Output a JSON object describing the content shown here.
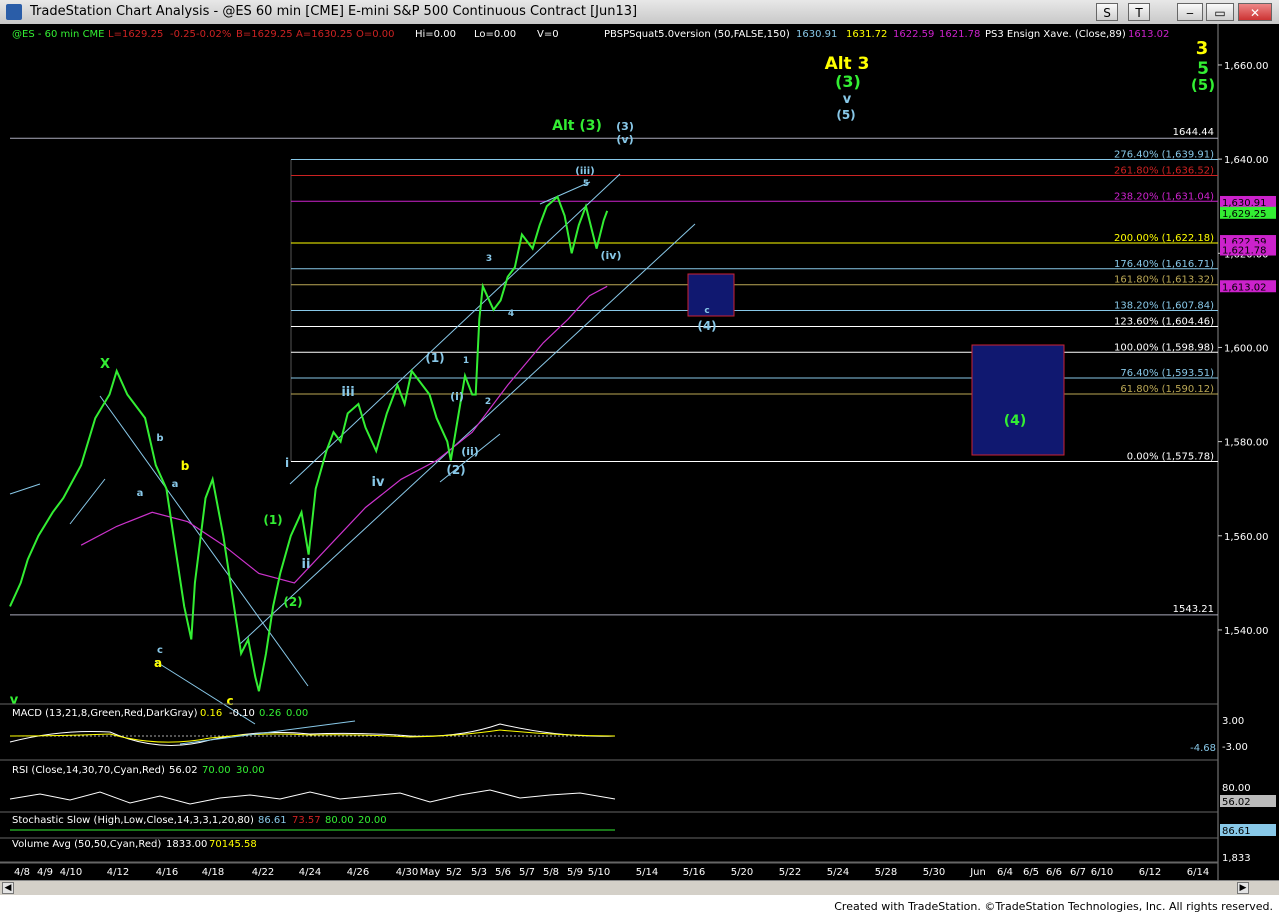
{
  "window": {
    "title": "TradeStation Chart Analysis - @ES 60 min [CME] E-mini S&P 500 Continuous Contract [Jun13]",
    "buttons": [
      "S",
      "T",
      "▭",
      "▭",
      "✕"
    ]
  },
  "colors": {
    "background": "#000000",
    "price": "#33ee33",
    "cyan": "#88c8e8",
    "ma": "#cc33cc",
    "yellow": "#ffff00",
    "fib_red": "#cc2222",
    "fib_magenta": "#cc22cc",
    "fib_olive": "#bba855",
    "box": "#101870"
  },
  "header": {
    "symbol": "@ES - 60 min  CME",
    "L": "L=1629.25",
    "chg": "-0.25",
    "pct": "-0.02%",
    "B": "B=1629.25",
    "A": "A=1630.25",
    "O": "O=0.00",
    "Hi": "Hi=0.00",
    "Lo": "Lo=0.00",
    "V": "V=0",
    "indicator_name": "PBSPSquat5.0version (50,FALSE,150)",
    "ind_vals": [
      "1630.91",
      "1631.72",
      "1622.59",
      "1621.78"
    ],
    "ind2_name": "PS3 Ensign Xave. (Close,89)",
    "ind2_val": "1613.02"
  },
  "chart_data": {
    "type": "line",
    "title": "@ES 60 min E-mini S&P 500 Continuous Contract",
    "ylim": [
      1523,
      1667
    ],
    "y_ticks": [
      {
        "v": 1660,
        "label": "1,660.00"
      },
      {
        "v": 1640,
        "label": "1,640.00"
      },
      {
        "v": 1620,
        "label": "1,620.00"
      },
      {
        "v": 1600,
        "label": "1,600.00"
      },
      {
        "v": 1580,
        "label": "1,580.00"
      },
      {
        "v": 1560,
        "label": "1,560.00"
      },
      {
        "v": 1540,
        "label": "1,540.00"
      }
    ],
    "x_labels": [
      "4/8",
      "4/9",
      "4/10",
      "4/12",
      "4/16",
      "4/18",
      "4/22",
      "4/24",
      "4/26",
      "4/30",
      "May",
      "5/2",
      "5/3",
      "5/6",
      "5/7",
      "5/8",
      "5/9",
      "5/10",
      "5/14",
      "5/16",
      "5/20",
      "5/22",
      "5/24",
      "5/28",
      "5/30",
      "Jun",
      "6/4",
      "6/5",
      "6/6",
      "6/7",
      "6/10",
      "6/12",
      "6/14"
    ],
    "price_path": [
      [
        1545,
        0
      ],
      [
        1550,
        3
      ],
      [
        1555,
        5
      ],
      [
        1560,
        8
      ],
      [
        1565,
        12
      ],
      [
        1568,
        15
      ],
      [
        1575,
        20
      ],
      [
        1585,
        24
      ],
      [
        1590,
        28
      ],
      [
        1595,
        30
      ],
      [
        1590,
        33
      ],
      [
        1585,
        38
      ],
      [
        1575,
        41
      ],
      [
        1570,
        44
      ],
      [
        1560,
        46
      ],
      [
        1545,
        49
      ],
      [
        1538,
        51
      ],
      [
        1550,
        52
      ],
      [
        1568,
        55
      ],
      [
        1572,
        57
      ],
      [
        1560,
        60
      ],
      [
        1545,
        63
      ],
      [
        1535,
        65
      ],
      [
        1538,
        67
      ],
      [
        1530,
        69
      ],
      [
        1527,
        70
      ],
      [
        1535,
        72
      ],
      [
        1545,
        74
      ],
      [
        1552,
        76
      ],
      [
        1560,
        79
      ],
      [
        1565,
        82
      ],
      [
        1556,
        84
      ],
      [
        1570,
        86
      ],
      [
        1578,
        89
      ],
      [
        1582,
        91
      ],
      [
        1580,
        93
      ],
      [
        1586,
        95
      ],
      [
        1588,
        98
      ],
      [
        1583,
        100
      ],
      [
        1578,
        103
      ],
      [
        1586,
        106
      ],
      [
        1592,
        109
      ],
      [
        1588,
        111
      ],
      [
        1595,
        113
      ],
      [
        1592,
        116
      ],
      [
        1590,
        118
      ],
      [
        1585,
        120
      ],
      [
        1580,
        123
      ],
      [
        1576,
        124
      ],
      [
        1585,
        126
      ],
      [
        1594,
        128
      ],
      [
        1590,
        130
      ],
      [
        1590,
        131
      ],
      [
        1606,
        132
      ],
      [
        1613,
        133
      ],
      [
        1608,
        136
      ],
      [
        1610,
        138
      ],
      [
        1615,
        140
      ],
      [
        1617,
        142
      ],
      [
        1624,
        144
      ],
      [
        1621,
        147
      ],
      [
        1626,
        149
      ],
      [
        1630,
        151
      ],
      [
        1632,
        154
      ],
      [
        1628,
        156
      ],
      [
        1620,
        158
      ],
      [
        1626,
        160
      ],
      [
        1630,
        162
      ],
      [
        1624,
        164
      ],
      [
        1621,
        165
      ],
      [
        1627,
        167
      ],
      [
        1629,
        168
      ]
    ],
    "x_index_range": [
      0,
      171
    ],
    "ma_path": [
      [
        1558,
        20
      ],
      [
        1562,
        30
      ],
      [
        1565,
        40
      ],
      [
        1563,
        50
      ],
      [
        1558,
        60
      ],
      [
        1552,
        70
      ],
      [
        1550,
        80
      ],
      [
        1558,
        90
      ],
      [
        1566,
        100
      ],
      [
        1572,
        110
      ],
      [
        1576,
        120
      ],
      [
        1582,
        130
      ],
      [
        1592,
        140
      ],
      [
        1601,
        150
      ],
      [
        1606,
        157
      ],
      [
        1611,
        163
      ],
      [
        1613,
        168
      ]
    ],
    "fib_levels": [
      {
        "label": "276.40% (1,639.91)",
        "value": 1639.91,
        "color": "#88c8e8"
      },
      {
        "label": "261.80% (1,636.52)",
        "value": 1636.52,
        "color": "#cc2222"
      },
      {
        "label": "238.20% (1,631.04)",
        "value": 1631.04,
        "color": "#cc22cc"
      },
      {
        "label": "200.00% (1,622.18)",
        "value": 1622.18,
        "color": "#ffff00"
      },
      {
        "label": "176.40% (1,616.71)",
        "value": 1616.71,
        "color": "#88c8e8"
      },
      {
        "label": "161.80% (1,613.32)",
        "value": 1613.32,
        "color": "#bba855"
      },
      {
        "label": "138.20% (1,607.84)",
        "value": 1607.84,
        "color": "#88c8e8"
      },
      {
        "label": "123.60% (1,604.46)",
        "value": 1604.46,
        "color": "#ffffff"
      },
      {
        "label": "100.00% (1,598.98)",
        "value": 1598.98,
        "color": "#ffffff"
      },
      {
        "label": "76.40% (1,593.51)",
        "value": 1593.51,
        "color": "#88c8e8"
      },
      {
        "label": "61.80% (1,590.12)",
        "value": 1590.12,
        "color": "#bba855"
      },
      {
        "label": "0.00% (1,575.78)",
        "value": 1575.78,
        "color": "#ffffff"
      }
    ],
    "horizontal_lines": [
      {
        "label": "1644.44",
        "value": 1644.44
      },
      {
        "label": "1543.21",
        "value": 1543.21
      }
    ],
    "price_flags": [
      {
        "label": "1,630.91",
        "value": 1630.9,
        "bg": "#cc22cc",
        "fg": "#000000"
      },
      {
        "label": "1,629.25",
        "value": 1628.6,
        "bg": "#33ee33",
        "fg": "#000000"
      },
      {
        "label": "1,622.59",
        "value": 1622.6,
        "bg": "#cc22cc",
        "fg": "#000000"
      },
      {
        "label": "1,621.78",
        "value": 1620.8,
        "bg": "#cc22cc",
        "fg": "#000000"
      },
      {
        "label": "1,613.02",
        "value": 1613.0,
        "bg": "#cc22cc",
        "fg": "#000000"
      }
    ],
    "wave_labels": [
      {
        "t": "X",
        "color": "#33ee33"
      },
      {
        "t": "b",
        "color": "#ffff00"
      },
      {
        "t": "b",
        "color": "#88c8e8"
      },
      {
        "t": "a",
        "color": "#88c8e8"
      },
      {
        "t": "a",
        "color": "#88c8e8"
      },
      {
        "t": "c",
        "color": "#88c8e8"
      },
      {
        "t": "a",
        "color": "#ffff00"
      },
      {
        "t": "c",
        "color": "#ffff00"
      },
      {
        "t": "v",
        "color": "#33ee33"
      },
      {
        "t": "(1)",
        "color": "#33ee33"
      },
      {
        "t": "(2)",
        "color": "#33ee33"
      },
      {
        "t": "i",
        "color": "#88c8e8"
      },
      {
        "t": "ii",
        "color": "#88c8e8"
      },
      {
        "t": "iii",
        "color": "#88c8e8"
      },
      {
        "t": "iv",
        "color": "#88c8e8"
      },
      {
        "t": "(1)",
        "color": "#88c8e8"
      },
      {
        "t": "(2)",
        "color": "#88c8e8"
      },
      {
        "t": "(i)",
        "color": "#88c8e8"
      },
      {
        "t": "(ii)",
        "color": "#88c8e8"
      },
      {
        "t": "1",
        "color": "#88c8e8"
      },
      {
        "t": "2",
        "color": "#88c8e8"
      },
      {
        "t": "3",
        "color": "#88c8e8"
      },
      {
        "t": "4",
        "color": "#88c8e8"
      },
      {
        "t": "5",
        "color": "#88c8e8"
      },
      {
        "t": "(iii)",
        "color": "#88c8e8"
      },
      {
        "t": "(iv)",
        "color": "#88c8e8"
      },
      {
        "t": "Alt (3)",
        "color": "#33ee33"
      },
      {
        "t": "(3)",
        "color": "#88c8e8"
      },
      {
        "t": "(v)",
        "color": "#88c8e8"
      },
      {
        "t": "c",
        "color": "#88c8e8"
      },
      {
        "t": "(4)",
        "color": "#88c8e8"
      },
      {
        "t": "(4)",
        "color": "#33ee33"
      },
      {
        "t": "Alt 3",
        "color": "#ffff00"
      },
      {
        "t": "(3)",
        "color": "#33ee33"
      },
      {
        "t": "v",
        "color": "#88c8e8"
      },
      {
        "t": "(5)",
        "color": "#88c8e8"
      },
      {
        "t": "3",
        "color": "#ffff00"
      },
      {
        "t": "5",
        "color": "#33ee33"
      },
      {
        "t": "(5)",
        "color": "#33ee33"
      }
    ]
  },
  "subpanels": {
    "macd": {
      "name": "MACD (13,21,8,Green,Red,DarkGray)",
      "v1": "0.16",
      "v2": "-0.10",
      "v3": "0.26",
      "v4": "0.00",
      "axis": [
        "3.00",
        "0.26",
        "-3.00"
      ],
      "flag": "-4.68"
    },
    "rsi": {
      "name": "RSI (Close,14,30,70,Cyan,Red)",
      "v1": "56.02",
      "v2": "70.00",
      "v3": "30.00",
      "axis": [
        "80.00",
        "56.02"
      ]
    },
    "stoch": {
      "name": "Stochastic Slow (High,Low,Close,14,3,3,1,20,80)",
      "v1": "86.61",
      "v2": "73.57",
      "v3": "80.00",
      "v4": "20.00",
      "axis": [
        "86.61"
      ]
    },
    "volume": {
      "name": "Volume Avg (50,50,Cyan,Red)",
      "v1": "1833.00",
      "v2": "70145.58",
      "axis": [
        "1,833"
      ]
    }
  },
  "footer": {
    "text": "Created with TradeStation. ©TradeStation Technologies, Inc. All rights reserved."
  }
}
